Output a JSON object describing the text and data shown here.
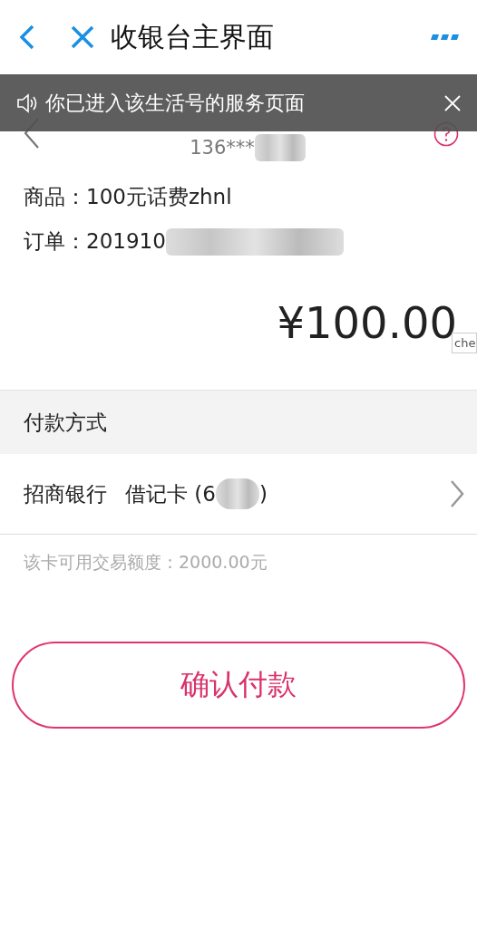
{
  "nav": {
    "title": "收银台主界面"
  },
  "toast": {
    "message": "你已进入该生活号的服务页面"
  },
  "merchant": {
    "phone": "136***"
  },
  "order": {
    "product": "商品：100元话费zhnl",
    "order_no": "订单：201910",
    "amount": "¥100.00"
  },
  "tooltip": "che",
  "payment": {
    "section_title": "付款方式",
    "bank": "招商银行",
    "card": "借记卡 (6",
    "card_end": ")",
    "limit_note": "该卡可用交易额度：2000.00元"
  },
  "confirm_button": "确认付款"
}
